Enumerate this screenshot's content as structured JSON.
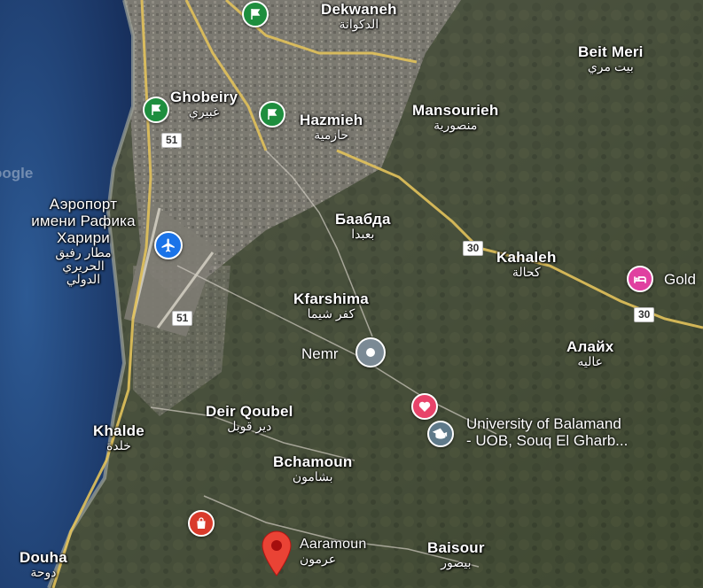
{
  "map": {
    "watermark": "oogle",
    "places": [
      {
        "id": "dekwaneh",
        "name": "Dekwaneh",
        "name_ar": "الدكوانة"
      },
      {
        "id": "beit-meri",
        "name": "Beit Meri",
        "name_ar": "بيت مري"
      },
      {
        "id": "ghobeiry",
        "name": "Ghobeiry",
        "name_ar": "غبيري"
      },
      {
        "id": "hazmieh",
        "name": "Hazmieh",
        "name_ar": "حازمية"
      },
      {
        "id": "mansourieh",
        "name": "Mansourieh",
        "name_ar": "منصورية"
      },
      {
        "id": "baabda",
        "name": "Баабда",
        "name_ar": "بعبدا"
      },
      {
        "id": "kahaleh",
        "name": "Kahaleh",
        "name_ar": "كحالة"
      },
      {
        "id": "kfarshima",
        "name": "Kfarshima",
        "name_ar": "كفر شيما"
      },
      {
        "id": "aley",
        "name": "Алайх",
        "name_ar": "عاليه"
      },
      {
        "id": "deir-qoubel",
        "name": "Deir Qoubel",
        "name_ar": "دير قوبل"
      },
      {
        "id": "khalde",
        "name": "Khalde",
        "name_ar": "خلدة"
      },
      {
        "id": "bchamoun",
        "name": "Bchamoun",
        "name_ar": "بشامون"
      },
      {
        "id": "baisour",
        "name": "Baisour",
        "name_ar": "بيصور"
      },
      {
        "id": "douha",
        "name": "Douha",
        "name_ar": "دوحة"
      },
      {
        "id": "aaramoun",
        "name": "Aaramoun",
        "name_ar": "عرمون"
      }
    ],
    "airport": {
      "line1": "Аэропорт",
      "line2": "имени Рафика",
      "line3": "Харири",
      "ar1": "مطار رفيق",
      "ar2": "الحريري",
      "ar3": "الدولي"
    },
    "road_shields": [
      "51",
      "51",
      "30",
      "30"
    ],
    "pois": {
      "nemr": "Nemr",
      "university_line1": "University of Balamand",
      "university_line2": "- UOB, Souq El Gharb...",
      "gold": "Gold"
    },
    "colors": {
      "sea": "#1d3c6e",
      "flag_pin": "#1e8e3e",
      "airport_pin": "#1a73e8",
      "hotel_pin": "#e040a0",
      "heart_pin": "#e8436a",
      "school_pin": "#5f7a8a",
      "shop_pin": "#d93a2b",
      "location_pin": "#ea4335",
      "gray_pin": "#7b8a95"
    }
  }
}
